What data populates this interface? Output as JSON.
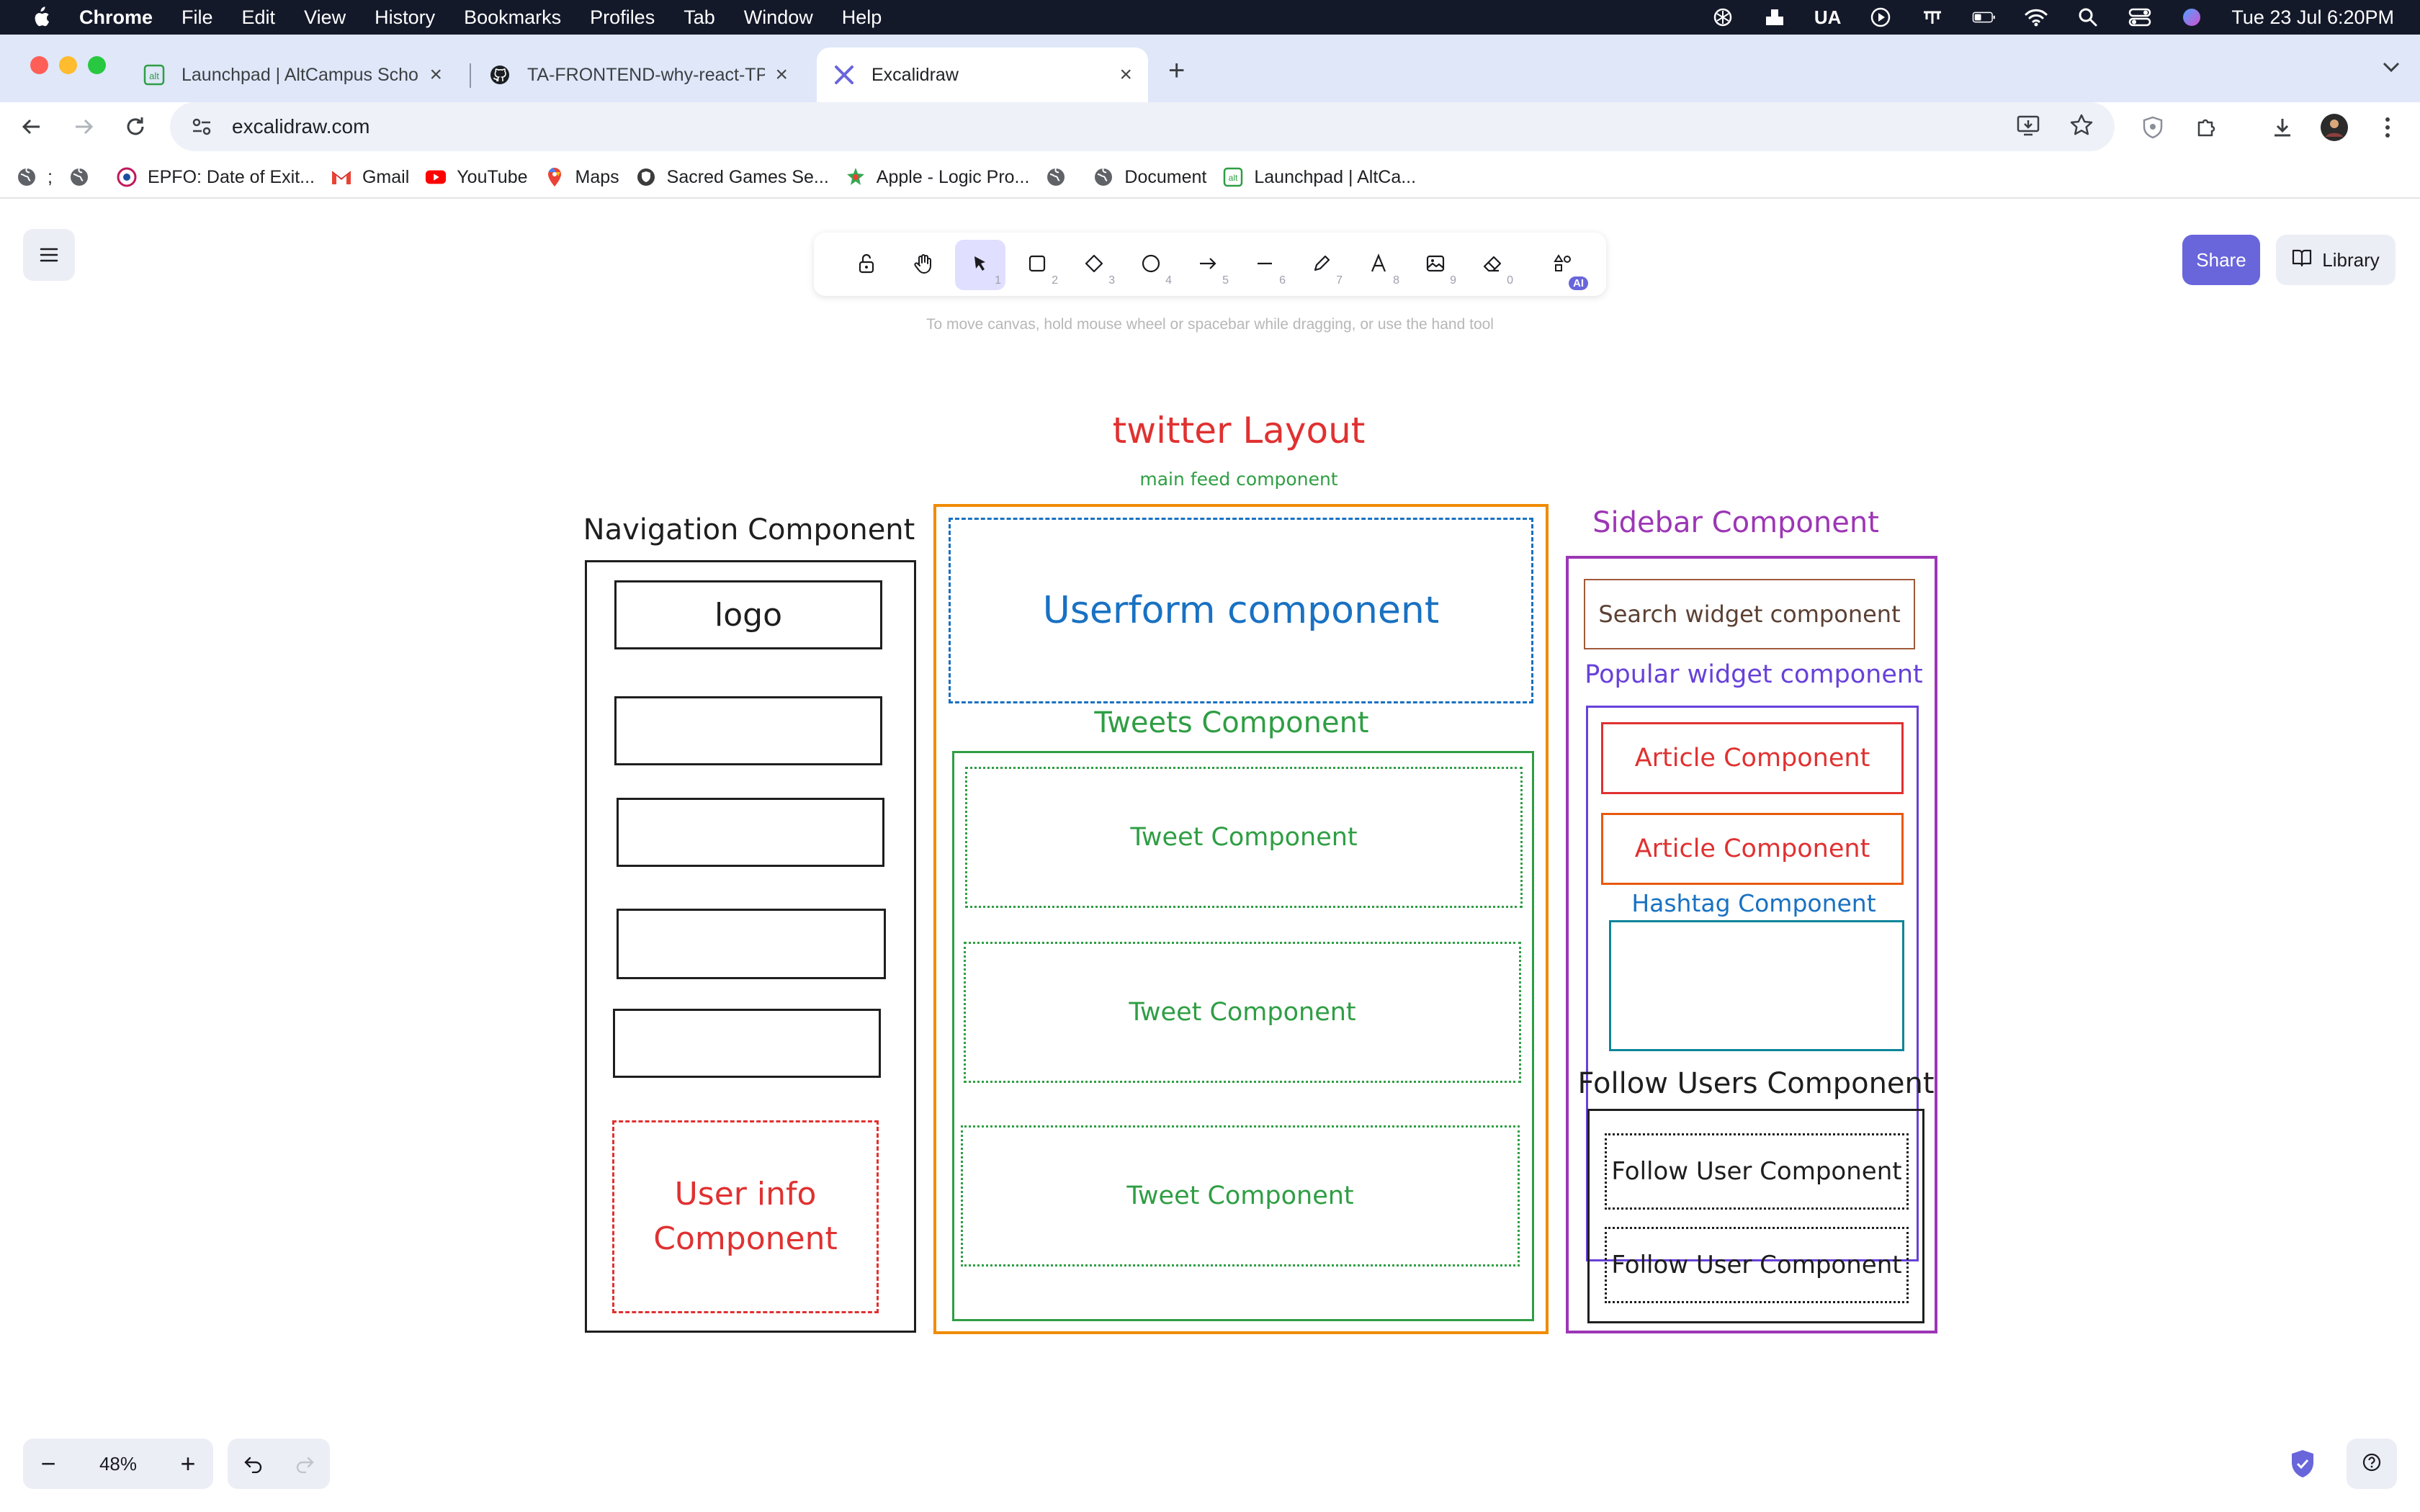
{
  "menubar": {
    "app_name": "Chrome",
    "items": [
      "File",
      "Edit",
      "View",
      "History",
      "Bookmarks",
      "Profiles",
      "Tab",
      "Window",
      "Help"
    ],
    "input_source": "UA",
    "clock": "Tue 23 Jul  6:20PM"
  },
  "tabs": [
    {
      "title": "Launchpad | AltCampus School",
      "icon": "altcampus-icon"
    },
    {
      "title": "TA-FRONTEND-why-react-TP",
      "icon": "github-icon"
    },
    {
      "title": "Excalidraw",
      "icon": "excalidraw-icon"
    }
  ],
  "omnibox": {
    "url": "excalidraw.com"
  },
  "bookmarks": [
    {
      "label": ";",
      "icon": "globe-icon"
    },
    {
      "label": "",
      "icon": "globe-icon"
    },
    {
      "label": "EPFO: Date of Exit...",
      "icon": "epfo-icon"
    },
    {
      "label": "Gmail",
      "icon": "gmail-icon"
    },
    {
      "label": "YouTube",
      "icon": "youtube-icon"
    },
    {
      "label": "Maps",
      "icon": "maps-icon"
    },
    {
      "label": "Sacred Games Se...",
      "icon": "shield-icon"
    },
    {
      "label": "Apple - Logic Pro...",
      "icon": "apple-logic-icon"
    },
    {
      "label": "",
      "icon": "globe-icon"
    },
    {
      "label": "Document",
      "icon": "globe-icon"
    },
    {
      "label": "Launchpad | AltCa...",
      "icon": "altcampus-icon"
    }
  ],
  "excalidraw": {
    "tools": [
      {
        "name": "lock",
        "key": ""
      },
      {
        "name": "hand",
        "key": ""
      },
      {
        "name": "selection",
        "key": "1"
      },
      {
        "name": "rectangle",
        "key": "2"
      },
      {
        "name": "diamond",
        "key": "3"
      },
      {
        "name": "ellipse",
        "key": "4"
      },
      {
        "name": "arrow",
        "key": "5"
      },
      {
        "name": "line",
        "key": "6"
      },
      {
        "name": "draw",
        "key": "7"
      },
      {
        "name": "text",
        "key": "8"
      },
      {
        "name": "image",
        "key": "9"
      },
      {
        "name": "eraser",
        "key": "0"
      },
      {
        "name": "more-tools",
        "key": "AI"
      }
    ],
    "hint": "To move canvas, hold mouse wheel or spacebar while dragging, or use the hand tool",
    "share_label": "Share",
    "library_label": "Library",
    "zoom": "48%"
  },
  "drawing": {
    "title": "twitter Layout",
    "main_feed_label": "main feed component",
    "navigation": {
      "label": "Navigation Component",
      "logo": "logo",
      "user_info": "User info Component"
    },
    "main": {
      "userform": "Userform component",
      "tweets_label": "Tweets Component",
      "tweets": [
        "Tweet Component",
        "Tweet Component",
        "Tweet Component"
      ]
    },
    "sidebar": {
      "label": "Sidebar Component",
      "search": "Search widget component",
      "popular_label": "Popular widget component",
      "articles": [
        "Article Component",
        "Article Component"
      ],
      "hashtag_label": "Hashtag Component",
      "follow_label": "Follow Users Component",
      "follow_items": [
        "Follow User Component",
        "Follow User Component"
      ]
    }
  },
  "colors": {
    "menubar_bg": "#14192a",
    "tabstrip_bg": "#dfe7f9",
    "accent": "#6965db",
    "red": "#e03131",
    "green": "#2f9e44",
    "blue": "#1971c2",
    "orange": "#f08c00",
    "purple": "#9c36b5"
  }
}
